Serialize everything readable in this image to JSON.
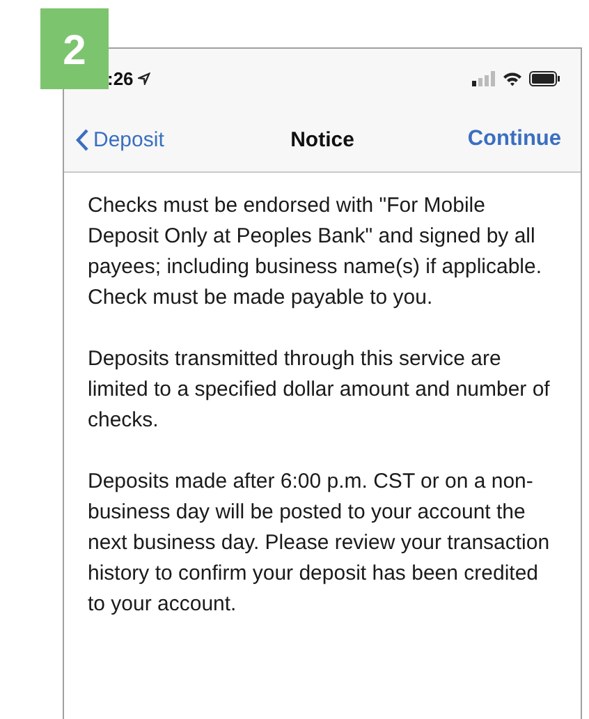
{
  "step_badge": "2",
  "status_bar": {
    "time": ":26"
  },
  "nav_bar": {
    "back": "Deposit",
    "title": "Notice",
    "action": "Continue"
  },
  "paragraphs": [
    "Checks must be endorsed with \"For Mobile Deposit Only at Peoples Bank\" and signed by all payees; including business name(s) if applicable. Check must be made payable to you.",
    "Deposits transmitted through this service are limited to a specified dollar amount and number of checks.",
    "Deposits made after 6:00 p.m. CST or on a non-business day will be posted to your account the next business day. Please review your transaction history to confirm your deposit has been credited to your account."
  ]
}
